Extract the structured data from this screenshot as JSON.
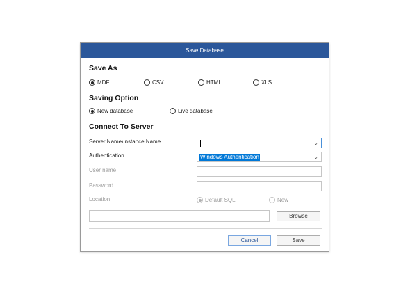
{
  "dialog": {
    "title": "Save Database",
    "save_as": {
      "heading": "Save As",
      "options": [
        "MDF",
        "CSV",
        "HTML",
        "XLS"
      ],
      "selected": "MDF"
    },
    "saving_option": {
      "heading": "Saving Option",
      "options": [
        "New database",
        "Live database"
      ],
      "selected": "New database"
    },
    "connect": {
      "heading": "Connect To Server",
      "server_label": "Server Name\\Instance Name",
      "server_value": "",
      "auth_label": "Authentication",
      "auth_value": "Windows Authentication",
      "username_label": "User name",
      "password_label": "Password",
      "location_label": "Location",
      "location_options": [
        "Default SQL",
        "New"
      ],
      "location_selected": "Default SQL"
    },
    "buttons": {
      "browse": "Browse",
      "cancel": "Cancel",
      "save": "Save"
    }
  }
}
